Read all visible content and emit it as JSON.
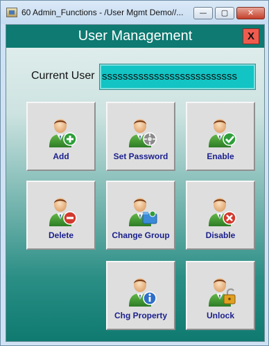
{
  "window": {
    "title": "60 Admin_Functions - /User Mgmt Demo//...",
    "minimize_glyph": "—",
    "maximize_glyph": "▢",
    "close_glyph": "✕"
  },
  "header": {
    "title": "User Management",
    "close_label": "X"
  },
  "current_user": {
    "label": "Current User",
    "value": "ssssssssssssssssssssssssss"
  },
  "buttons": [
    {
      "label": "Add",
      "icon": "user-add-icon",
      "badge_color": "#2e9e3a"
    },
    {
      "label": "Set Password",
      "icon": "user-set-password-icon",
      "badge_color": "#8a8a8a"
    },
    {
      "label": "Enable",
      "icon": "user-enable-icon",
      "badge_color": "#2e9e3a"
    },
    {
      "label": "Delete",
      "icon": "user-delete-icon",
      "badge_color": "#d23a2f"
    },
    {
      "label": "Change Group",
      "icon": "user-change-group-icon",
      "badge_color": "#3a8ad8"
    },
    {
      "label": "Disable",
      "icon": "user-disable-icon",
      "badge_color": "#d23a2f"
    },
    {
      "label": "Chg Property",
      "icon": "user-property-icon",
      "badge_color": "#2f6fc8"
    },
    {
      "label": "Unlock",
      "icon": "user-unlock-icon",
      "badge_color": "#e0a020"
    }
  ]
}
